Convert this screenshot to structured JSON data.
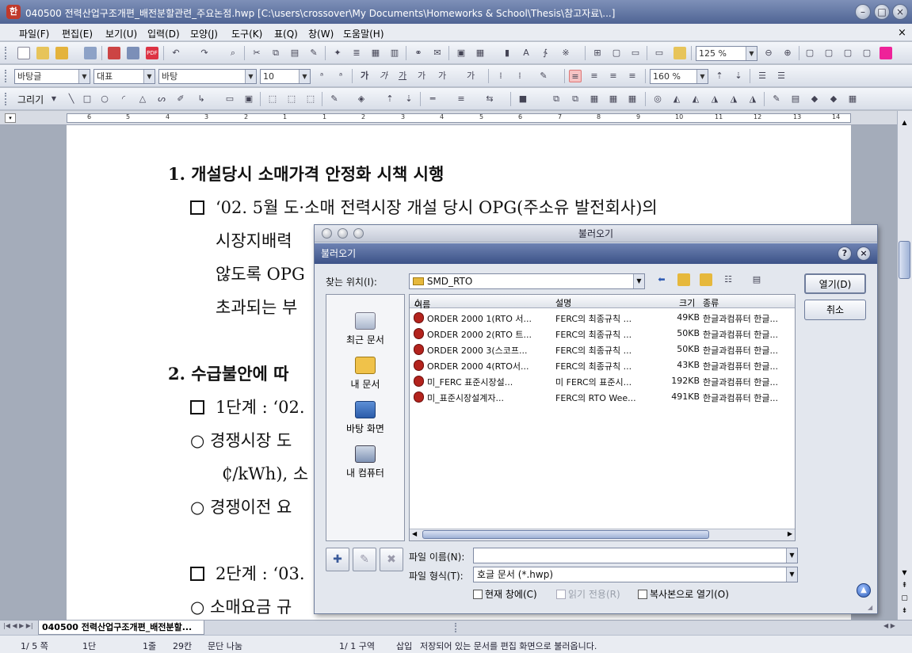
{
  "window": {
    "title": "040500 전력산업구조개편_배전분할관련_주요논점.hwp [C:\\users\\crossover\\My Documents\\Homeworks & School\\Thesis\\참고자료\\...]",
    "app_icon": "한"
  },
  "menu": [
    "파일(F)",
    "편집(E)",
    "보기(U)",
    "입력(D)",
    "모양(J)",
    "도구(K)",
    "표(Q)",
    "창(W)",
    "도움말(H)"
  ],
  "toolbar": {
    "zoom": "125 %",
    "style": "바탕글",
    "font_lang": "대표",
    "font": "바탕",
    "font_size": "10",
    "line_spacing": "160 %",
    "draw_label": "그리기"
  },
  "ruler": {
    "ticks": [
      "6",
      "5",
      "4",
      "3",
      "2",
      "1",
      "1",
      "2",
      "3",
      "4",
      "5",
      "6",
      "7",
      "8",
      "9",
      "10",
      "11",
      "12",
      "13",
      "14"
    ]
  },
  "document": {
    "lines": [
      "1. 개설당시 소매가격 안정화 시책 시행",
      "‘02. 5월 도·소매 전력시장 개설 당시 OPG(주소유 발전회사)의",
      "시장지배력",
      "않도록 OPG",
      "초과되는 부",
      "2. 수급불안에 따",
      "1단계 : ‘02.",
      "○  경쟁시장 도",
      "₵/kWh), 소",
      "○  경쟁이전 요",
      "2단계 : ‘03.",
      "○  소매요금 규"
    ]
  },
  "tabs": {
    "active": "040500 전력산업구조개편_배전분할..."
  },
  "status": {
    "page": "1/ 5 쪽",
    "column": "1단",
    "line": "1줄",
    "col": "29칸",
    "mode": "문단 나눔",
    "section": "1/ 1 구역",
    "insert": "삽입",
    "message": "저장되어 있는 문서를 편집 화면으로 불러옵니다."
  },
  "dialog": {
    "window_title": "불러오기",
    "title": "불러오기",
    "look_in_label": "찾는 위치(I):",
    "look_in_value": "SMD_RTO",
    "open_button": "열기(D)",
    "cancel_button": "취소",
    "places": [
      "최근 문서",
      "내 문서",
      "바탕 화면",
      "내 컴퓨터"
    ],
    "columns": {
      "name": "이름",
      "desc": "설명",
      "size": "크기",
      "type": "종류"
    },
    "files": [
      {
        "name": "ORDER 2000 1(RTO 서...",
        "desc": "FERC의 최종규칙 ...",
        "size": "49KB",
        "type": "한글과컴퓨터 한글..."
      },
      {
        "name": "ORDER 2000 2(RTO 트...",
        "desc": "FERC의 최종규칙 ...",
        "size": "50KB",
        "type": "한글과컴퓨터 한글..."
      },
      {
        "name": "ORDER 2000 3(스코프...",
        "desc": "FERC의 최종규칙 ...",
        "size": "50KB",
        "type": "한글과컴퓨터 한글..."
      },
      {
        "name": "ORDER 2000 4(RTO서...",
        "desc": "FERC의 최종규칙 ...",
        "size": "43KB",
        "type": "한글과컴퓨터 한글..."
      },
      {
        "name": "미_FERC 표준시장설...",
        "desc": "미 FERC의 표준시...",
        "size": "192KB",
        "type": "한글과컴퓨터 한글..."
      },
      {
        "name": "미_표준시장설계자...",
        "desc": "FERC의 RTO Wee...",
        "size": "491KB",
        "type": "한글과컴퓨터 한글..."
      }
    ],
    "filename_label": "파일 이름(N):",
    "filename_value": "",
    "filetype_label": "파일 형식(T):",
    "filetype_value": "호글 문서 (*.hwp)",
    "options": [
      {
        "label": "현재 창에(C)",
        "checked": false,
        "enabled": true
      },
      {
        "label": "읽기 전용(R)",
        "checked": false,
        "enabled": false
      },
      {
        "label": "복사본으로 열기(O)",
        "checked": false,
        "enabled": true
      }
    ]
  }
}
